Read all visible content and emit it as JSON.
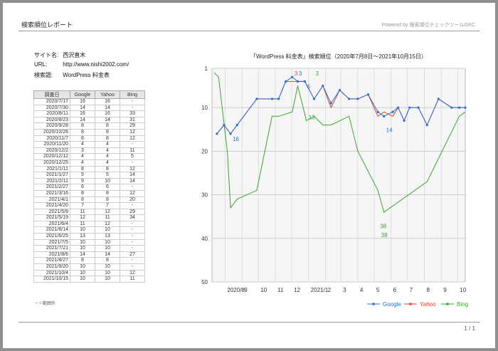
{
  "header": {
    "title": "検索順位レポート",
    "powered": "Powered by 検索順位チェックツールGRC"
  },
  "info": {
    "site_label": "サイト名:",
    "site_value": "西沢直木",
    "url_label": "URL:",
    "url_value": "http://www.nishi2002.com/",
    "keyword_label": "検索語:",
    "keyword_value": "WordPress 料金表"
  },
  "table": {
    "headers": [
      "調査日",
      "Google",
      "Yahoo",
      "Bing"
    ],
    "rows": [
      [
        "2020/7/17",
        "16",
        "16",
        "-"
      ],
      [
        "2020/7/30",
        "14",
        "14",
        "-"
      ],
      [
        "2020/8/11",
        "16",
        "16",
        "33"
      ],
      [
        "2020/8/23",
        "14",
        "14",
        "31"
      ],
      [
        "2020/9/28",
        "8",
        "8",
        "29"
      ],
      [
        "2020/10/26",
        "8",
        "8",
        "12"
      ],
      [
        "2020/11/7",
        "8",
        "8",
        "12"
      ],
      [
        "2020/11/20",
        "4",
        "4",
        "-"
      ],
      [
        "2020/12/2",
        "3",
        "4",
        "11"
      ],
      [
        "2020/12/12",
        "4",
        "4",
        "5"
      ],
      [
        "2020/12/25",
        "4",
        "4",
        "-"
      ],
      [
        "2021/1/11",
        "8",
        "8",
        "12"
      ],
      [
        "2021/1/27",
        "5",
        "5",
        "14"
      ],
      [
        "2021/2/11",
        "9",
        "10",
        "14"
      ],
      [
        "2021/2/27",
        "6",
        "6",
        "-"
      ],
      [
        "2021/3/16",
        "8",
        "8",
        "12"
      ],
      [
        "2021/4/1",
        "8",
        "8",
        "20"
      ],
      [
        "2021/4/20",
        "7",
        "7",
        "-"
      ],
      [
        "2021/5/8",
        "11",
        "12",
        "29"
      ],
      [
        "2021/5/19",
        "12",
        "11",
        "34"
      ],
      [
        "2021/6/4",
        "11",
        "12",
        "-"
      ],
      [
        "2021/6/14",
        "10",
        "10",
        "-"
      ],
      [
        "2021/6/25",
        "13",
        "13",
        "-"
      ],
      [
        "2021/7/5",
        "10",
        "10",
        "-"
      ],
      [
        "2021/7/21",
        "10",
        "10",
        "-"
      ],
      [
        "2021/8/6",
        "14",
        "14",
        "27"
      ],
      [
        "2021/8/27",
        "8",
        "8",
        "-"
      ],
      [
        "2021/9/20",
        "10",
        "10",
        "-"
      ],
      [
        "2021/10/4",
        "10",
        "10",
        "12"
      ],
      [
        "2021/10/15",
        "10",
        "10",
        "11"
      ]
    ]
  },
  "note": "－＝範囲外",
  "footer": {
    "page": "1 / 1"
  },
  "colors": {
    "google": "#2b6fd6",
    "yahoo": "#e8402a",
    "bing": "#3aa52f"
  },
  "chart_data": {
    "type": "line",
    "title": "「WordPress 料金表」検索順位（2020年7月8日～2021年10月15日）",
    "x_range": [
      "2020-07-08",
      "2021-10-15"
    ],
    "x_tick_labels": [
      "2020/8",
      "9",
      "10",
      "11",
      "12",
      "2021/1",
      "2",
      "3",
      "4",
      "5",
      "6",
      "7",
      "8",
      "9",
      "10"
    ],
    "y_ticks": [
      1,
      10,
      20,
      30,
      40,
      50
    ],
    "ylim": [
      1,
      50
    ],
    "y_reversed": true,
    "y_tick_labels": [
      "1",
      "10",
      "20",
      "30",
      "40",
      "50"
    ],
    "annotations": [
      {
        "series": "Google",
        "x": "2020-08-11",
        "y": 16,
        "label": "16"
      },
      {
        "series": "Yahoo",
        "x": "2020-12-02",
        "y": 3,
        "label": "3"
      },
      {
        "series": "Google",
        "x": "2020-12-10",
        "y": 3,
        "label": "3"
      },
      {
        "series": "Google",
        "x": "2020-12-25",
        "y": 6,
        "label": "6"
      },
      {
        "series": "Bing",
        "x": "2021-01-10",
        "y": 3,
        "label": "3"
      },
      {
        "series": "Bing",
        "x": "2020-12-28",
        "y": 13,
        "label": "13"
      },
      {
        "series": "Bing",
        "x": "2021-05-08",
        "y": 38,
        "label": "38"
      },
      {
        "series": "Bing",
        "x": "2021-05-10",
        "y": 40,
        "label": "38"
      },
      {
        "series": "Google",
        "x": "2021-05-19",
        "y": 14,
        "label": "14"
      }
    ],
    "series": [
      {
        "name": "Google",
        "color": "#2b6fd6",
        "x": [
          "2020-07-17",
          "2020-07-30",
          "2020-08-11",
          "2020-08-23",
          "2020-09-28",
          "2020-10-26",
          "2020-11-07",
          "2020-11-20",
          "2020-12-02",
          "2020-12-12",
          "2020-12-25",
          "2021-01-11",
          "2021-01-27",
          "2021-02-11",
          "2021-02-27",
          "2021-03-16",
          "2021-04-01",
          "2021-04-20",
          "2021-05-08",
          "2021-05-19",
          "2021-06-04",
          "2021-06-14",
          "2021-06-25",
          "2021-07-05",
          "2021-07-21",
          "2021-08-06",
          "2021-08-27",
          "2021-09-20",
          "2021-10-04",
          "2021-10-15"
        ],
        "values": [
          16,
          14,
          16,
          14,
          8,
          8,
          8,
          4,
          3,
          4,
          4,
          8,
          5,
          9,
          6,
          8,
          8,
          7,
          11,
          12,
          11,
          10,
          13,
          10,
          10,
          14,
          8,
          10,
          10,
          10
        ]
      },
      {
        "name": "Yahoo",
        "color": "#e8402a",
        "x": [
          "2020-07-17",
          "2020-07-30",
          "2020-08-11",
          "2020-08-23",
          "2020-09-28",
          "2020-10-26",
          "2020-11-07",
          "2020-11-20",
          "2020-12-02",
          "2020-12-12",
          "2020-12-25",
          "2021-01-11",
          "2021-01-27",
          "2021-02-11",
          "2021-02-27",
          "2021-03-16",
          "2021-04-01",
          "2021-04-20",
          "2021-05-08",
          "2021-05-19",
          "2021-06-04",
          "2021-06-14",
          "2021-06-25",
          "2021-07-05",
          "2021-07-21",
          "2021-08-06",
          "2021-08-27",
          "2021-09-20",
          "2021-10-04",
          "2021-10-15"
        ],
        "values": [
          16,
          14,
          16,
          14,
          8,
          8,
          8,
          4,
          4,
          4,
          4,
          8,
          5,
          10,
          6,
          8,
          8,
          7,
          12,
          11,
          12,
          10,
          13,
          10,
          10,
          14,
          8,
          10,
          10,
          10
        ]
      },
      {
        "name": "Bing",
        "color": "#3aa52f",
        "x": [
          "2020-07-12",
          "2020-07-20",
          "2020-08-05",
          "2020-08-11",
          "2020-08-23",
          "2020-09-28",
          "2020-10-26",
          "2020-11-07",
          "2020-12-02",
          "2020-12-12",
          "2020-12-28",
          "2021-01-11",
          "2021-01-27",
          "2021-02-11",
          "2021-03-16",
          "2021-04-01",
          "2021-05-08",
          "2021-05-19",
          "2021-08-06",
          "2021-10-04",
          "2021-10-15"
        ],
        "values": [
          2,
          3,
          20,
          33,
          31,
          29,
          12,
          12,
          11,
          5,
          13,
          12,
          14,
          14,
          12,
          20,
          29,
          34,
          27,
          12,
          11
        ]
      }
    ]
  }
}
